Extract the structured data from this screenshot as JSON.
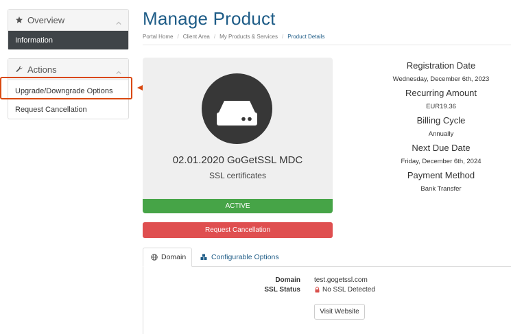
{
  "sidebar": {
    "overview": {
      "title": "Overview",
      "items": [
        {
          "label": "Information"
        }
      ]
    },
    "actions": {
      "title": "Actions",
      "items": [
        {
          "label": "Upgrade/Downgrade Options"
        },
        {
          "label": "Request Cancellation"
        }
      ]
    }
  },
  "page": {
    "title": "Manage Product",
    "breadcrumb": [
      "Portal Home",
      "Client Area",
      "My Products & Services",
      "Product Details"
    ]
  },
  "product": {
    "name": "02.01.2020 GoGetSSL MDC",
    "group": "SSL certificates",
    "status": "ACTIVE"
  },
  "cancel_button": "Request Cancellation",
  "details": [
    {
      "label": "Registration Date",
      "value": "Wednesday, December 6th, 2023"
    },
    {
      "label": "Recurring Amount",
      "value": "EUR19.36"
    },
    {
      "label": "Billing Cycle",
      "value": "Annually"
    },
    {
      "label": "Next Due Date",
      "value": "Friday, December 6th, 2024"
    },
    {
      "label": "Payment Method",
      "value": "Bank Transfer"
    }
  ],
  "tabs": [
    {
      "label": "Domain"
    },
    {
      "label": "Configurable Options"
    }
  ],
  "domain_tab": {
    "domain_label": "Domain",
    "domain_value": "test.gogetssl.com",
    "ssl_label": "SSL Status",
    "ssl_value": "No SSL Detected",
    "visit_button": "Visit Website"
  },
  "colors": {
    "title_blue": "#1e5c87",
    "status_green": "#46a447",
    "cancel_red": "#df4f50",
    "highlight_orange": "#d9480f",
    "sidebar_active": "#3f4448"
  },
  "icons": {
    "overview": "star-icon",
    "actions": "wrench-icon",
    "product": "server-icon",
    "domain_tab": "globe-icon",
    "config_tab": "cubes-icon",
    "ssl_status": "lock-icon"
  }
}
